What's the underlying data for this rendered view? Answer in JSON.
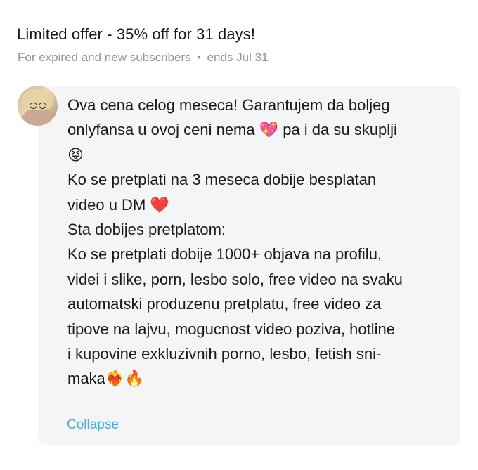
{
  "offer": {
    "title": "Limited offer - 35% off for 31 days!",
    "audience": "For expired and new subscribers",
    "separator": "•",
    "ends": "ends Jul 31"
  },
  "message": {
    "lines": [
      "Ova cena celog meseca! Garantujem da boljeg",
      "onlyfansa u ovoj ceni nema 💖 pa i da su skuplji",
      "😝",
      "Ko se pretplati na 3 meseca dobije besplatan",
      "video u DM ❤️",
      "Sta dobijes pretplatom:",
      "Ko se pretplati dobije 1000+ objava na profilu,",
      "videi i slike, porn, lesbo solo, free video na svaku",
      "automatski produzenu pretplatu, free video za",
      "tipove na lajvu, mogucnost video poziva, hotline",
      "i kupovine exkluzivnih porno, lesbo, fetish sni-",
      "maka❤️‍🔥🔥"
    ],
    "collapse_label": "Collapse"
  },
  "avatar_icon": "user-avatar-photo",
  "colors": {
    "accent": "#4aa9de",
    "muted": "#8a96a3",
    "bubble": "#f4f5f7"
  }
}
